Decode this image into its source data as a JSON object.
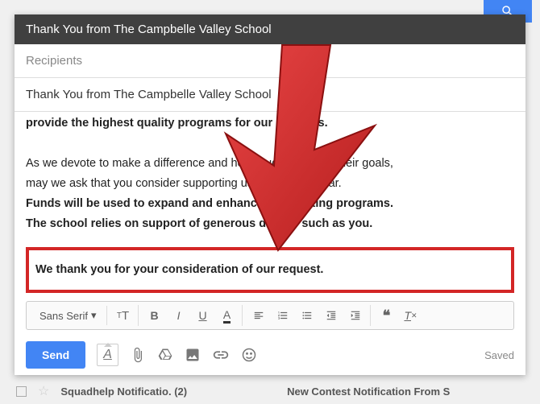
{
  "header": {
    "title": "Thank You from The Campbelle Valley School"
  },
  "recipients": {
    "placeholder": "Recipients"
  },
  "subject": {
    "text": "Thank You from The Campbelle Valley School"
  },
  "body": {
    "cutoff_line": "provide the highest quality programs for our students.",
    "para1_line1": "As we devote to make a difference and help students reach their goals,",
    "para1_line2": "may we ask that you consider supporting us for another year.",
    "bold_line1": "Funds will be used to expand and enhance our existing programs.",
    "bold_line2": "The school relies on support of generous donors such as you.",
    "highlighted": "We thank you for your consideration of our request."
  },
  "toolbar": {
    "font_label": "Sans Serif",
    "send_label": "Send",
    "saved_label": "Saved"
  },
  "bg": {
    "sender": "Squadhelp Notificatio.",
    "count": "(2)",
    "subject": "New Contest Notification From S"
  }
}
